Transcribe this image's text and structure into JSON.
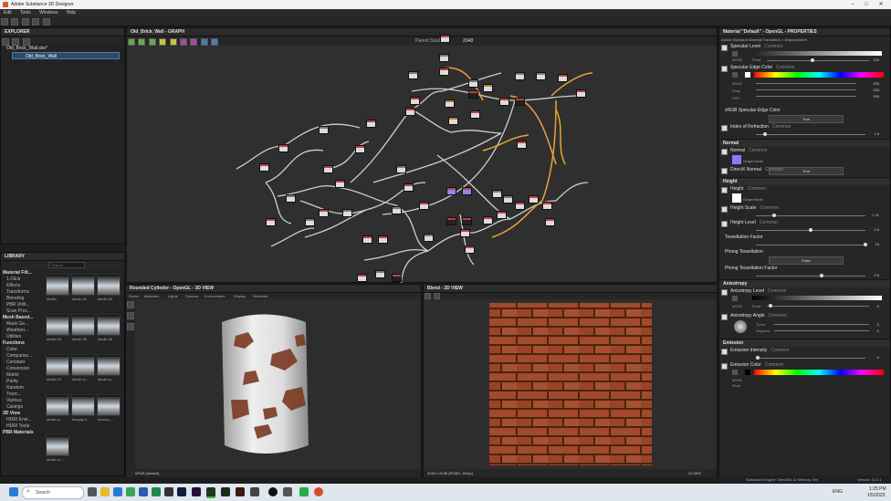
{
  "window": {
    "title": "Adobe Substance 3D Designer"
  },
  "menu": [
    "Edit",
    "Tools",
    "Windows",
    "Help"
  ],
  "explorer": {
    "title": "EXPLORER",
    "package": "Old_Brick_Wall.sbs*",
    "graph": "Old_Brick_Wall"
  },
  "graph_panel": {
    "title": "Old_Brick_Wall - GRAPH",
    "parent_size_label": "Parent Size:",
    "size_a": "2048",
    "size_b": "2048"
  },
  "library": {
    "title": "LIBRARY",
    "search_placeholder": "Search",
    "tree": [
      {
        "label": "Material Filt...",
        "type": "cat"
      },
      {
        "label": "1-Click",
        "type": "item"
      },
      {
        "label": "Effects",
        "type": "item"
      },
      {
        "label": "Transforms",
        "type": "item"
      },
      {
        "label": "Blending",
        "type": "item"
      },
      {
        "label": "PBR Utilit...",
        "type": "item"
      },
      {
        "label": "Scan Proc...",
        "type": "item"
      },
      {
        "label": "Mesh Based...",
        "type": "cat"
      },
      {
        "label": "Mask Ge...",
        "type": "item"
      },
      {
        "label": "Weatheri...",
        "type": "item"
      },
      {
        "label": "Utilities",
        "type": "item"
      },
      {
        "label": "Functions",
        "type": "cat"
      },
      {
        "label": "Color",
        "type": "item"
      },
      {
        "label": "Compariso...",
        "type": "item"
      },
      {
        "label": "Constant",
        "type": "item"
      },
      {
        "label": "Conversion",
        "type": "item"
      },
      {
        "label": "Matrix",
        "type": "item"
      },
      {
        "label": "Parity",
        "type": "item"
      },
      {
        "label": "Random",
        "type": "item"
      },
      {
        "label": "Trunc...",
        "type": "item"
      },
      {
        "label": "Various",
        "type": "item"
      },
      {
        "label": "Casings",
        "type": "item"
      },
      {
        "label": "3D View",
        "type": "cat"
      },
      {
        "label": "HDRI Envi...",
        "type": "item"
      },
      {
        "label": "HDRI Tools",
        "type": "item"
      },
      {
        "label": "PBR Materials",
        "type": "cat"
      }
    ],
    "thumbs": [
      {
        "label": "studio"
      },
      {
        "label": "studio 02"
      },
      {
        "label": "studio 03"
      },
      {
        "label": "studio 04"
      },
      {
        "label": "studio 05"
      },
      {
        "label": "studio 06"
      },
      {
        "label": "studio 10"
      },
      {
        "label": "studio w..."
      },
      {
        "label": "studio w..."
      },
      {
        "label": "studio w..."
      },
      {
        "label": "bequsy s..."
      },
      {
        "label": "tomocc_..."
      },
      {
        "label": "urban ex..."
      }
    ]
  },
  "view3d": {
    "title": "Rounded Cylinder - OpenGL - 3D VIEW",
    "menu": [
      "Scene",
      "Materials",
      "Lights",
      "Camera",
      "Environment",
      "Display",
      "Renderer"
    ],
    "colorspace": "sRGB (default)"
  },
  "view2d": {
    "title": "Blend - 2D VIEW",
    "status": "2048 x 2048 (RGBA, 16bpc)",
    "zoom": "22.66%"
  },
  "properties": {
    "title": "Material \"Default\" - OpenGL - PROPERTIES",
    "breadcrumb": "Adobe Standard Material/Translation > Displacement",
    "specular_level": {
      "label": "Specular Level",
      "tag": "Common",
      "value": "128",
      "mode": "sRGB",
      "mode2": "Float"
    },
    "specular_edge_color": {
      "label": "Specular Edge Color",
      "tag": "Common",
      "r": "255",
      "g": "255",
      "b": "255",
      "mode": "sRGB",
      "mode2": "Float",
      "mode3": "HSV"
    },
    "srgb_specular": {
      "label": "sRGB Specular Edge Color",
      "value": "True"
    },
    "ior": {
      "label": "Index of Refraction",
      "tag": "Common",
      "value": "1.5"
    },
    "normal_section": "Normal",
    "normal": {
      "label": "Normal",
      "tag": "Common",
      "src": "Graph Node"
    },
    "directx": {
      "label": "DirectX Normal",
      "tag": "Common",
      "value": "True"
    },
    "height_section": "Height",
    "height": {
      "label": "Height",
      "tag": "Common",
      "src": "Graph Node"
    },
    "height_scale": {
      "label": "Height Scale",
      "tag": "Common",
      "value": "1.11"
    },
    "height_level": {
      "label": "Height Level",
      "tag": "Common",
      "value": "0.5"
    },
    "tess": {
      "label": "Tessellation Factor",
      "value": "16"
    },
    "phong": {
      "label": "Phong Tessellation",
      "value": "False"
    },
    "phong_factor": {
      "label": "Phong Tessellation Factor",
      "value": "0.6"
    },
    "aniso_section": "Anisotropy",
    "aniso_level": {
      "label": "Anisotropy Level",
      "tag": "Common",
      "value": "0",
      "mode": "sRGB",
      "mode2": "Float"
    },
    "aniso_angle": {
      "label": "Anisotropy Angle",
      "tag": "Common",
      "turns": "Turns",
      "degrees": "Degrees",
      "v1": "0",
      "v2": "0"
    },
    "emission_section": "Emission",
    "emission_intensity": {
      "label": "Emission Intensity",
      "tag": "Common",
      "value": "0"
    },
    "emission_color": {
      "label": "Emission Color",
      "tag": "Common",
      "mode": "sRGB",
      "mode2": "Float"
    },
    "status": "Substance Engine: Direct3D 11  Memory: 8%",
    "version": "Version: 12.4.1"
  },
  "taskbar": {
    "search_placeholder": "Search",
    "lang": "ENG",
    "time": "1:25 PM",
    "date": "1/5/2023"
  },
  "colors": {
    "accent_orange": "#e8a23a",
    "node_red": "#c04040",
    "brick": "#a0482a"
  }
}
